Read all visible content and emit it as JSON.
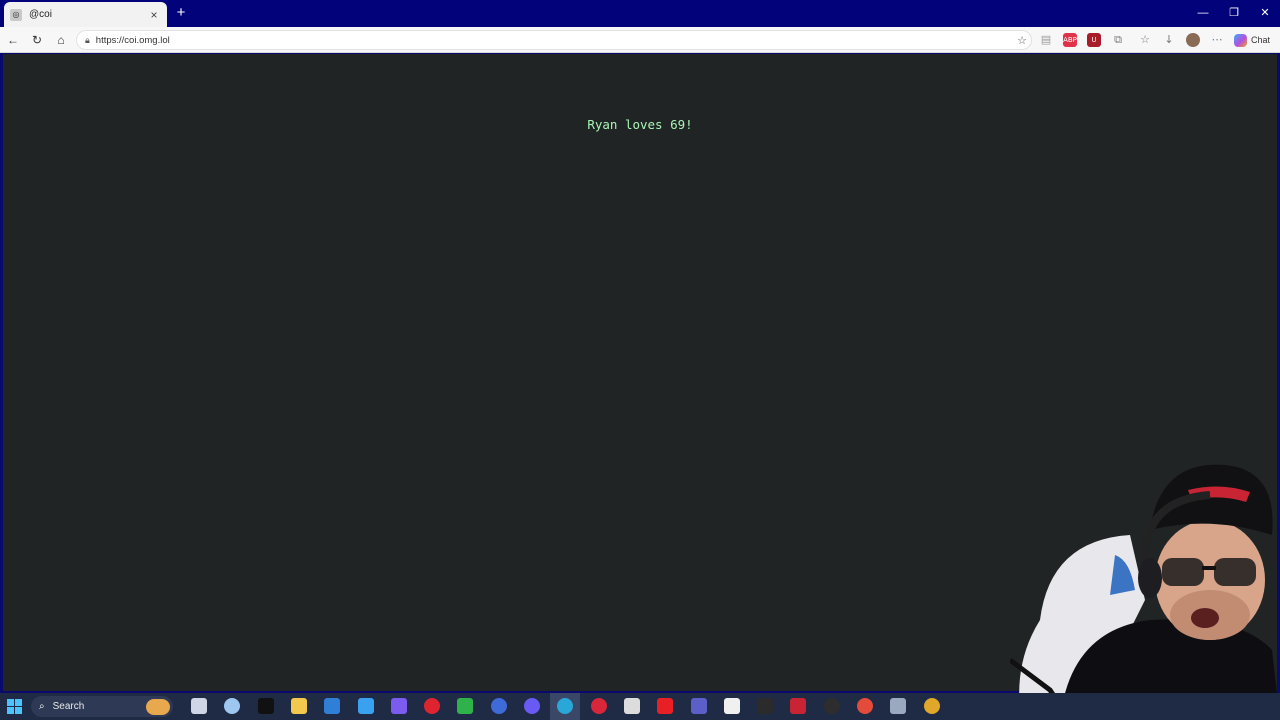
{
  "browser": {
    "tab_title": "@coi",
    "tab_favicon": "page-icon",
    "url": "https://coi.omg.lol",
    "chat_label": "Chat",
    "new_tab_label": "+",
    "close_tab_label": "×"
  },
  "toolbar_icons": [
    "back-icon",
    "refresh-icon",
    "home-icon"
  ],
  "extensions": [
    {
      "name": "reading-view-icon",
      "color": "#9a9a9a",
      "glyph": "▤"
    },
    {
      "name": "adblock-icon",
      "color": "#e0334a",
      "glyph": "ABP"
    },
    {
      "name": "ublock-icon",
      "color": "#a81c2a",
      "glyph": "U"
    },
    {
      "name": "extensions-icon",
      "color": "#777777",
      "glyph": "⧉"
    },
    {
      "name": "favorites-icon",
      "color": "#777777",
      "glyph": "☆"
    },
    {
      "name": "downloads-icon",
      "color": "#777777",
      "glyph": "↓"
    },
    {
      "name": "profile-avatar-icon",
      "color": "#8a6b55",
      "glyph": ""
    },
    {
      "name": "more-icon",
      "color": "#777777",
      "glyph": "⋯"
    }
  ],
  "page": {
    "message": "Ryan loves 69!",
    "text_color": "#a9f5b5",
    "background": "#212425"
  },
  "taskbar": {
    "search_label": "Search",
    "icons": [
      {
        "name": "task-view-icon",
        "color": "#cfd6e6"
      },
      {
        "name": "weather-icon",
        "color": "#9ec7f0"
      },
      {
        "name": "tiktok-icon",
        "color": "#111111"
      },
      {
        "name": "file-explorer-icon",
        "color": "#f2c94c"
      },
      {
        "name": "outlook-icon",
        "color": "#2f7fd6"
      },
      {
        "name": "store-icon",
        "color": "#3aa0f0"
      },
      {
        "name": "copilot-icon",
        "color": "#7c5cf0"
      },
      {
        "name": "opera-icon",
        "color": "#e0242f"
      },
      {
        "name": "xbox-icon",
        "color": "#2fb24a"
      },
      {
        "name": "edge-beta-icon",
        "color": "#3f6bd9"
      },
      {
        "name": "discord-icon",
        "color": "#6a5af5"
      },
      {
        "name": "edge-icon",
        "color": "#29a7d8"
      },
      {
        "name": "opera-gx-icon",
        "color": "#d8263a"
      },
      {
        "name": "clapper-icon",
        "color": "#dcdcdc"
      },
      {
        "name": "youtube-icon",
        "color": "#e81f24"
      },
      {
        "name": "teams-icon",
        "color": "#5b5fc7"
      },
      {
        "name": "notepad-icon",
        "color": "#f0f0f0"
      },
      {
        "name": "terminal-icon",
        "color": "#2b2b2b"
      },
      {
        "name": "voicemeeter-icon",
        "color": "#c92434"
      },
      {
        "name": "obs-icon",
        "color": "#2d2d2d"
      },
      {
        "name": "davinci-icon",
        "color": "#e34b3b"
      },
      {
        "name": "settings-icon",
        "color": "#9aa8c0"
      },
      {
        "name": "chrome-icon",
        "color": "#e0a72a"
      }
    ]
  }
}
